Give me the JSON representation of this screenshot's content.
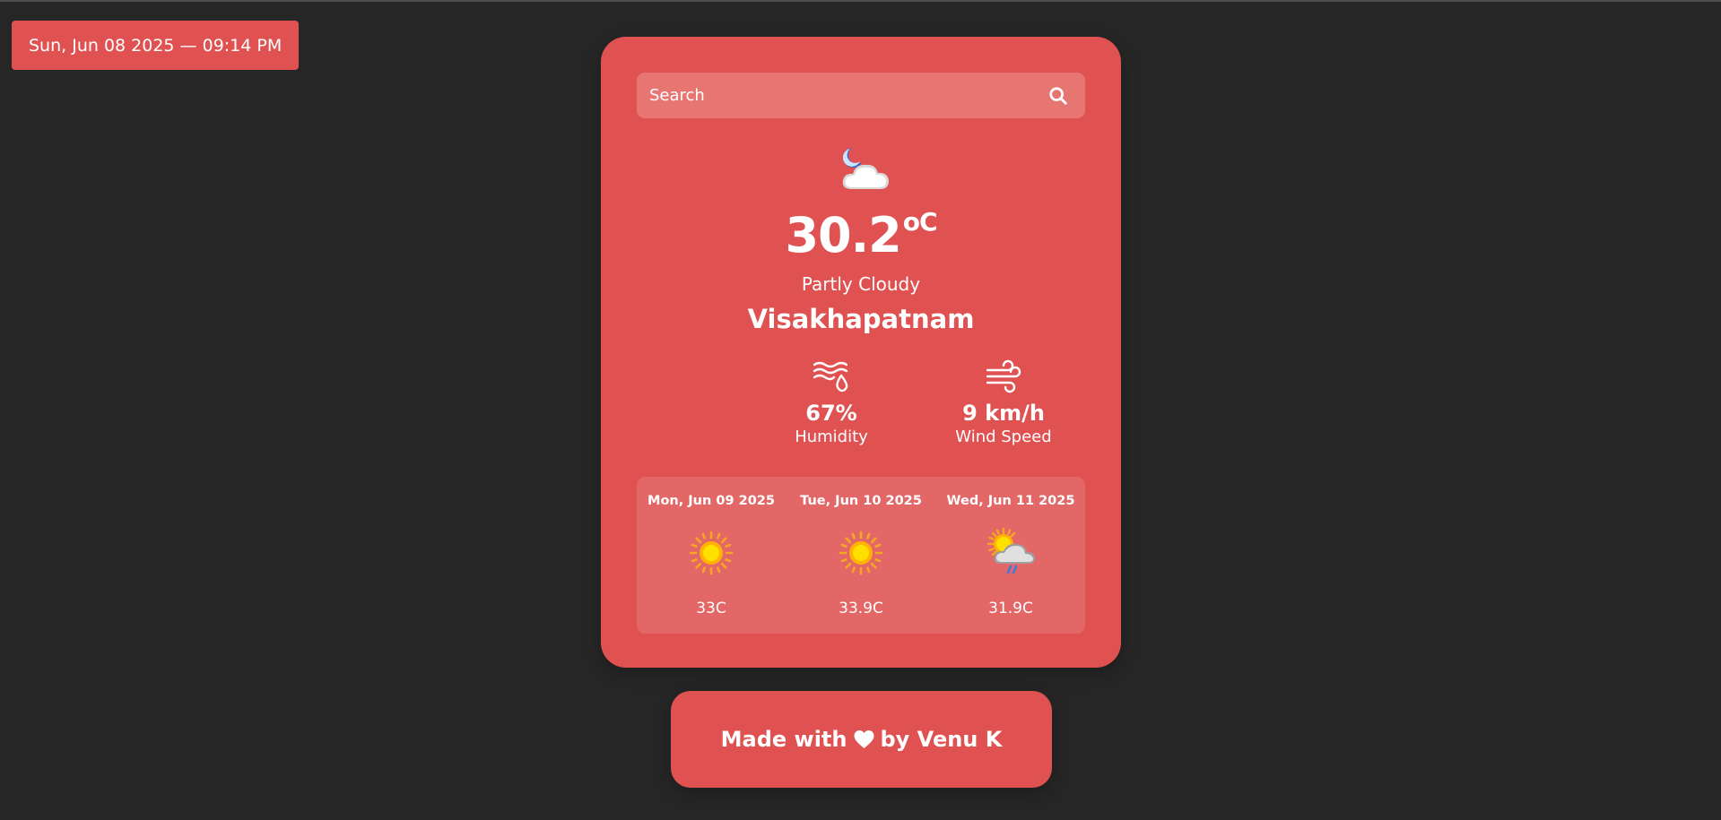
{
  "datetime": "Sun, Jun 08 2025 — 09:14 PM",
  "search": {
    "placeholder": "Search",
    "icon": "search-icon"
  },
  "current": {
    "icon": "moon-cloud-icon",
    "temperature": "30.2",
    "unit": "oC",
    "condition": "Partly Cloudy",
    "city": "Visakhapatnam",
    "humidity": {
      "icon": "humidity-icon",
      "value": "67%",
      "label": "Humidity"
    },
    "wind": {
      "icon": "wind-icon",
      "value": "9 km/h",
      "label": "Wind Speed"
    }
  },
  "forecast": [
    {
      "date": "Mon, Jun 09 2025",
      "icon": "sun-icon",
      "temp": "33C"
    },
    {
      "date": "Tue, Jun 10 2025",
      "icon": "sun-icon",
      "temp": "33.9C"
    },
    {
      "date": "Wed, Jun 11 2025",
      "icon": "sun-cloud-rain-icon",
      "temp": "31.9C"
    }
  ],
  "footer": {
    "prefix": "Made with",
    "suffix": "by Venu K",
    "icon": "heart-icon"
  },
  "colors": {
    "background": "#262626",
    "card": "#e05252",
    "search_bg": "#e77673",
    "forecast_bg": "#e36767",
    "text": "#ffffff"
  }
}
